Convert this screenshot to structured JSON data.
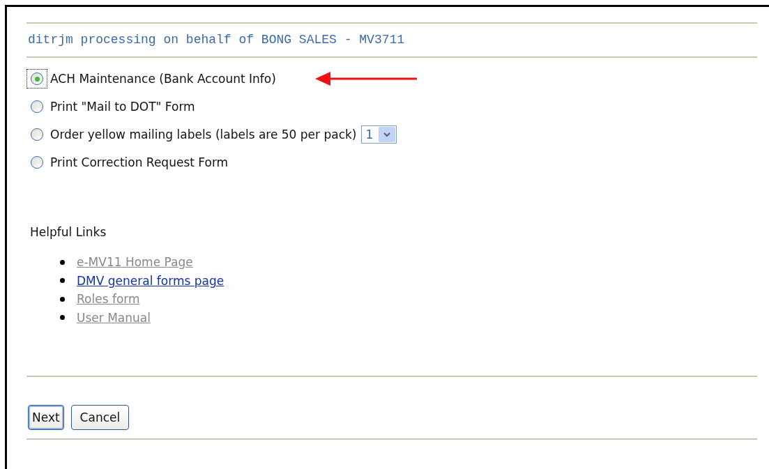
{
  "heading": "ditrjm processing on behalf of BONG SALES - MV3711",
  "options": [
    {
      "label": "ACH Maintenance (Bank Account Info)",
      "selected": true,
      "arrow": true
    },
    {
      "label": "Print \"Mail to DOT\" Form",
      "selected": false
    },
    {
      "label": "Order yellow mailing labels (labels are 50 per pack)",
      "selected": false,
      "dropdown": "1"
    },
    {
      "label": "Print Correction Request Form",
      "selected": false
    }
  ],
  "links_title": "Helpful Links",
  "links": [
    {
      "label": "e-MV11 Home Page",
      "visited": true
    },
    {
      "label": "DMV general forms page",
      "visited": false
    },
    {
      "label": "Roles form",
      "visited": true
    },
    {
      "label": "User Manual",
      "visited": true
    }
  ],
  "buttons": [
    {
      "label": "Next",
      "focused": true
    },
    {
      "label": "Cancel",
      "focused": false
    }
  ]
}
